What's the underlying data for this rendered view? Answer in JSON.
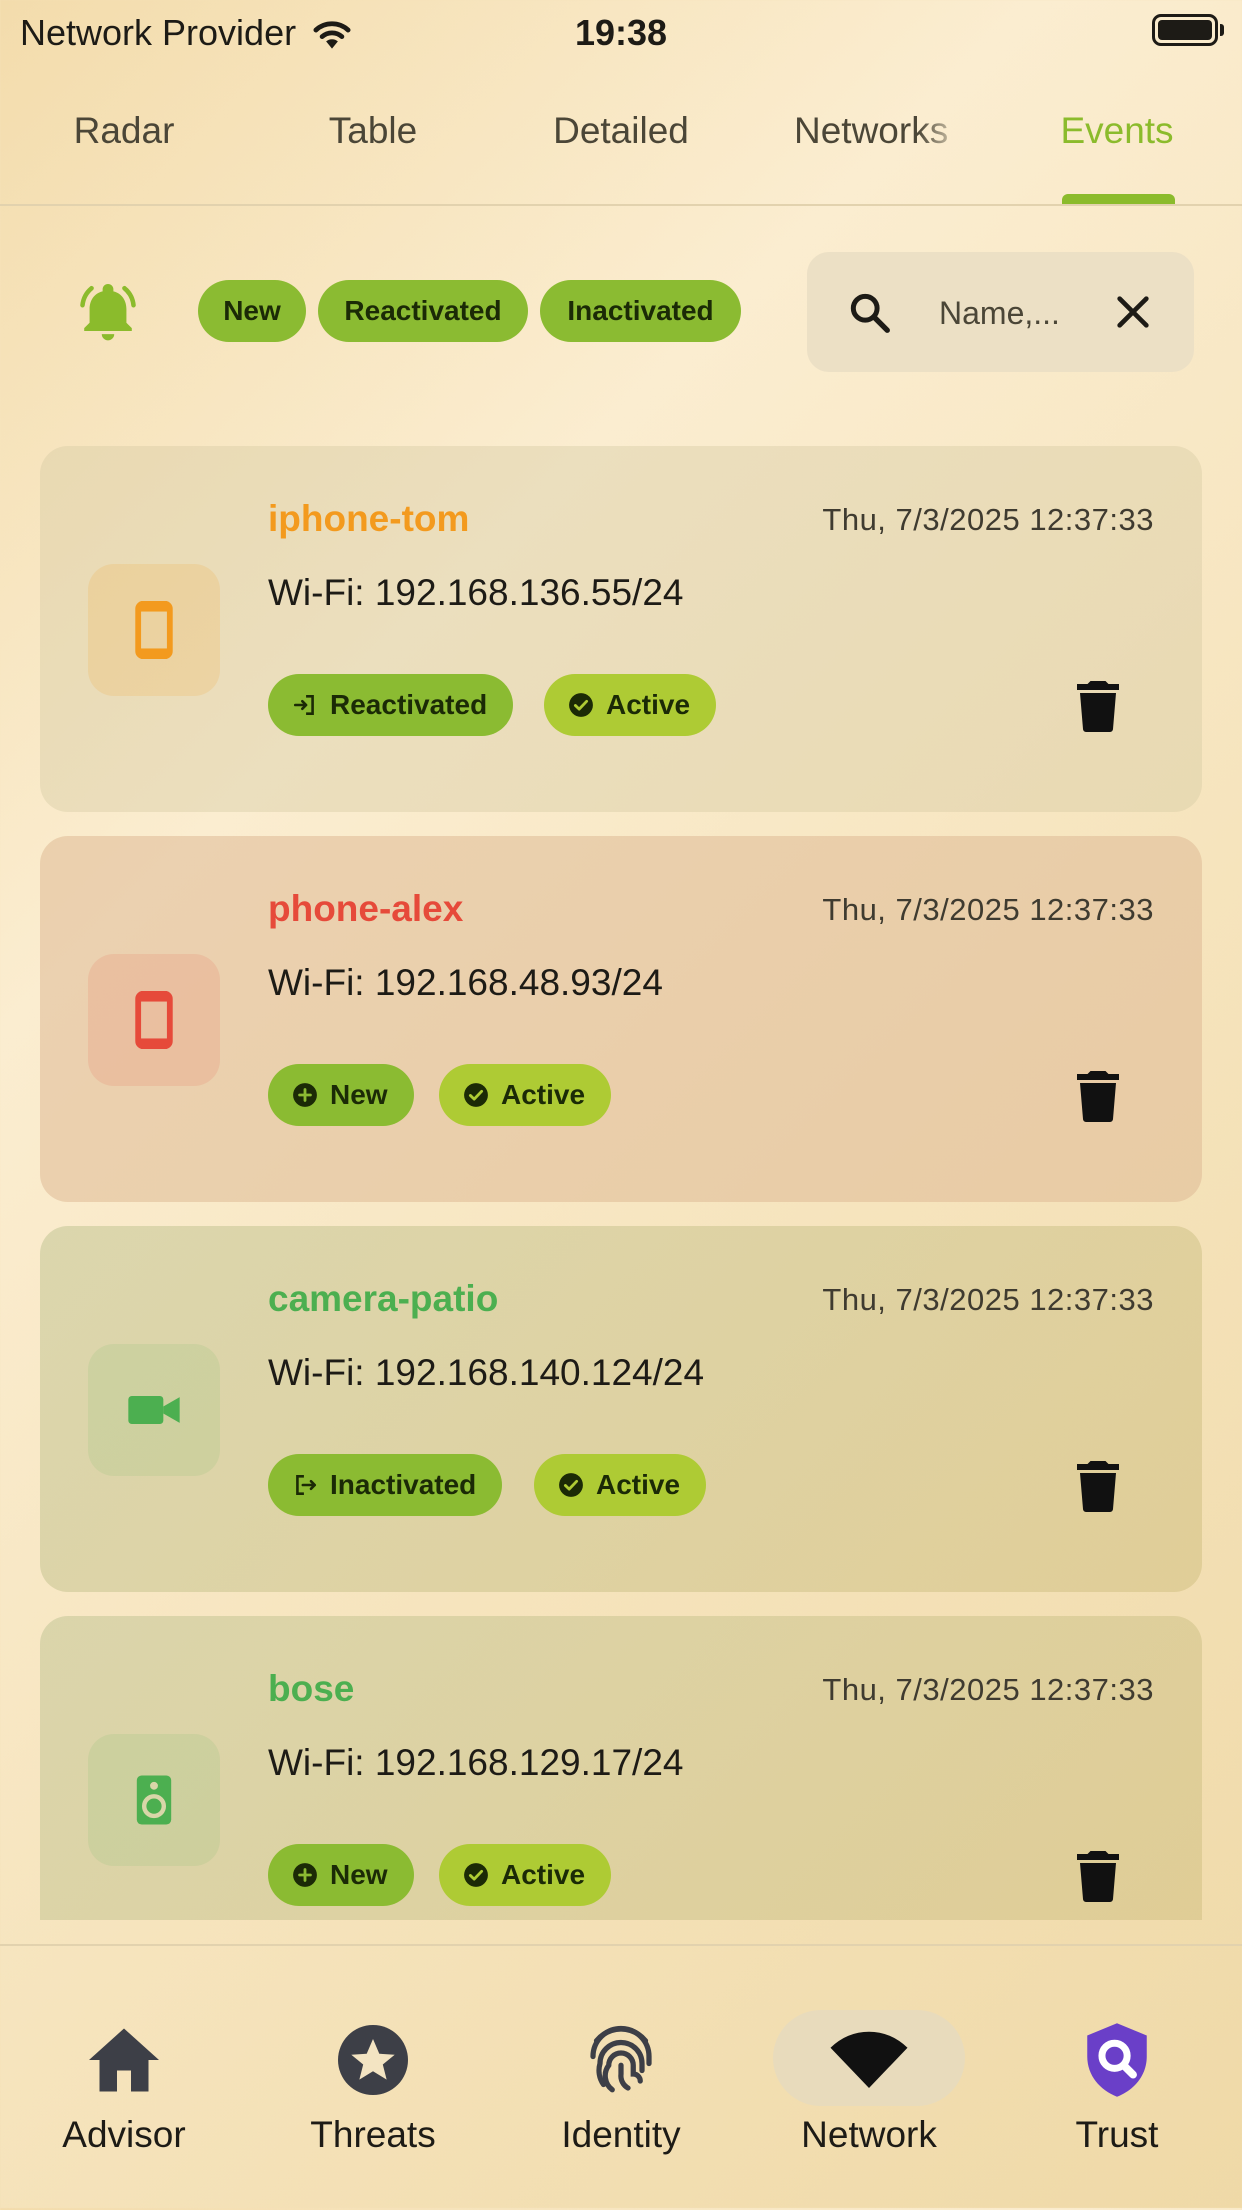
{
  "status_bar": {
    "carrier": "Network Provider",
    "time": "19:38"
  },
  "tabs": [
    {
      "label": "Radar",
      "active": false
    },
    {
      "label": "Table",
      "active": false
    },
    {
      "label": "Detailed",
      "active": false
    },
    {
      "label": "Networks",
      "active": false
    },
    {
      "label": "Events",
      "active": true
    }
  ],
  "filters": {
    "chips": [
      "New",
      "Reactivated",
      "Inactivated"
    ],
    "search_placeholder": "Name,..."
  },
  "events": [
    {
      "name": "iphone-tom",
      "time": "Thu, 7/3/2025 12:37:33",
      "address": "Wi-Fi: 192.168.136.55/24",
      "event": "Reactivated",
      "status": "Active",
      "icon": "phone-icon",
      "color": "#f39a1e"
    },
    {
      "name": "phone-alex",
      "time": "Thu, 7/3/2025 12:37:33",
      "address": "Wi-Fi: 192.168.48.93/24",
      "event": "New",
      "status": "Active",
      "icon": "phone-icon",
      "color": "#e64a3a"
    },
    {
      "name": "camera-patio",
      "time": "Thu, 7/3/2025 12:37:33",
      "address": "Wi-Fi: 192.168.140.124/24",
      "event": "Inactivated",
      "status": "Active",
      "icon": "video-camera-icon",
      "color": "#4caf50"
    },
    {
      "name": "bose",
      "time": "Thu, 7/3/2025 12:37:33",
      "address": "Wi-Fi: 192.168.129.17/24",
      "event": "New",
      "status": "Active",
      "icon": "speaker-icon",
      "color": "#4caf50"
    }
  ],
  "bottom_nav": [
    {
      "label": "Advisor",
      "icon": "home-icon",
      "active": false
    },
    {
      "label": "Threats",
      "icon": "star-badge-icon",
      "active": false
    },
    {
      "label": "Identity",
      "icon": "fingerprint-icon",
      "active": false
    },
    {
      "label": "Network",
      "icon": "wifi-icon",
      "active": true
    },
    {
      "label": "Trust",
      "icon": "shield-search-icon",
      "active": false
    }
  ],
  "colors": {
    "accent": "#8bbb2c",
    "chip": "#8bbb32",
    "status_chip": "#aecb34",
    "trust_purple": "#6a3fc8"
  }
}
